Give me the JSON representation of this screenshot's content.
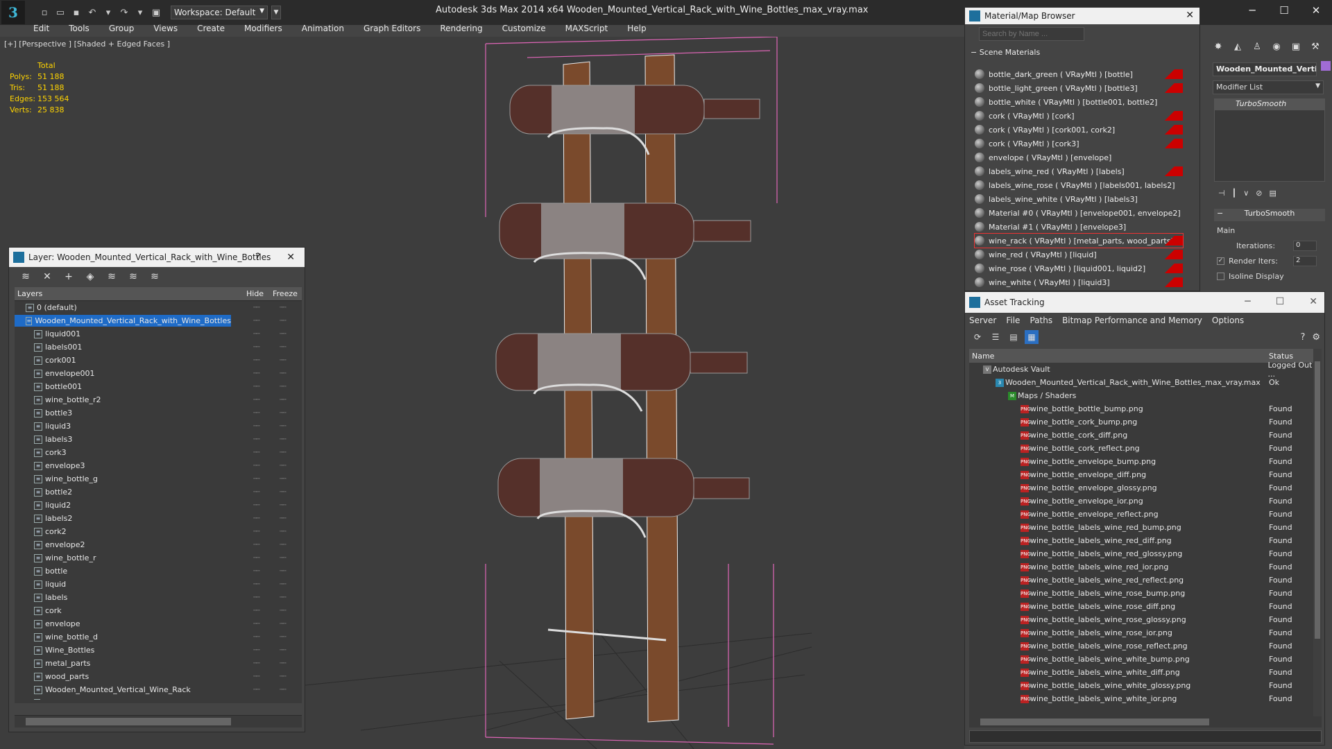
{
  "app": {
    "title": "Autodesk 3ds Max  2014 x64      Wooden_Mounted_Vertical_Rack_with_Wine_Bottles_max_vray.max",
    "workspace": "Workspace: Default",
    "logo": "3"
  },
  "menu": [
    "Edit",
    "Tools",
    "Group",
    "Views",
    "Create",
    "Modifiers",
    "Animation",
    "Graph Editors",
    "Rendering",
    "Customize",
    "MAXScript",
    "Help"
  ],
  "viewport": {
    "label": "[+] [Perspective ] [Shaded + Edged Faces ]",
    "stats": {
      "header": "Total",
      "polys_label": "Polys:",
      "polys": "51 188",
      "tris_label": "Tris:",
      "tris": "51 188",
      "edges_label": "Edges:",
      "edges": "153 564",
      "verts_label": "Verts:",
      "verts": "25 838"
    }
  },
  "layer_panel": {
    "title": "Layer: Wooden_Mounted_Vertical_Rack_with_Wine_Bottles",
    "help": "?",
    "close": "✕",
    "col_layers": "Layers",
    "col_hide": "Hide",
    "col_freeze": "Freeze",
    "rows": [
      {
        "name": "0 (default)",
        "indent": 1,
        "selected": false
      },
      {
        "name": "Wooden_Mounted_Vertical_Rack_with_Wine_Bottles",
        "indent": 1,
        "selected": true
      },
      {
        "name": "liquid001",
        "indent": 2
      },
      {
        "name": "labels001",
        "indent": 2
      },
      {
        "name": "cork001",
        "indent": 2
      },
      {
        "name": "envelope001",
        "indent": 2
      },
      {
        "name": "bottle001",
        "indent": 2
      },
      {
        "name": "wine_bottle_r2",
        "indent": 2
      },
      {
        "name": "bottle3",
        "indent": 2
      },
      {
        "name": "liquid3",
        "indent": 2
      },
      {
        "name": "labels3",
        "indent": 2
      },
      {
        "name": "cork3",
        "indent": 2
      },
      {
        "name": "envelope3",
        "indent": 2
      },
      {
        "name": "wine_bottle_g",
        "indent": 2
      },
      {
        "name": "bottle2",
        "indent": 2
      },
      {
        "name": "liquid2",
        "indent": 2
      },
      {
        "name": "labels2",
        "indent": 2
      },
      {
        "name": "cork2",
        "indent": 2
      },
      {
        "name": "envelope2",
        "indent": 2
      },
      {
        "name": "wine_bottle_r",
        "indent": 2
      },
      {
        "name": "bottle",
        "indent": 2
      },
      {
        "name": "liquid",
        "indent": 2
      },
      {
        "name": "labels",
        "indent": 2
      },
      {
        "name": "cork",
        "indent": 2
      },
      {
        "name": "envelope",
        "indent": 2
      },
      {
        "name": "wine_bottle_d",
        "indent": 2
      },
      {
        "name": "Wine_Bottles",
        "indent": 2
      },
      {
        "name": "metal_parts",
        "indent": 2
      },
      {
        "name": "wood_parts",
        "indent": 2
      },
      {
        "name": "Wooden_Mounted_Vertical_Wine_Rack",
        "indent": 2
      },
      {
        "name": "Wooden_Mounted_Vertical_Rack_with_Wine_Bottles",
        "indent": 2
      }
    ]
  },
  "material_browser": {
    "title": "Material/Map Browser",
    "search_placeholder": "Search by Name ...",
    "section": "Scene Materials",
    "items": [
      {
        "label": "bottle_dark_green  ( VRayMtl )  [bottle]",
        "badge": true
      },
      {
        "label": "bottle_light_green  ( VRayMtl )  [bottle3]",
        "badge": true
      },
      {
        "label": "bottle_white  ( VRayMtl )  [bottle001, bottle2]",
        "badge": false
      },
      {
        "label": "cork  ( VRayMtl )  [cork]",
        "badge": true
      },
      {
        "label": "cork  ( VRayMtl )  [cork001, cork2]",
        "badge": true
      },
      {
        "label": "cork  ( VRayMtl )  [cork3]",
        "badge": true
      },
      {
        "label": "envelope  ( VRayMtl )  [envelope]",
        "badge": false
      },
      {
        "label": "labels_wine_red  ( VRayMtl )  [labels]",
        "badge": true
      },
      {
        "label": "labels_wine_rose  ( VRayMtl )  [labels001, labels2]",
        "badge": false
      },
      {
        "label": "labels_wine_white  ( VRayMtl )  [labels3]",
        "badge": false
      },
      {
        "label": "Material #0  ( VRayMtl )  [envelope001, envelope2]",
        "badge": false
      },
      {
        "label": "Material #1  ( VRayMtl )  [envelope3]",
        "badge": false
      },
      {
        "label": "wine_rack  ( VRayMtl )  [metal_parts, wood_parts]",
        "badge": true,
        "selected": true
      },
      {
        "label": "wine_red  ( VRayMtl )  [liquid]",
        "badge": true
      },
      {
        "label": "wine_rose  ( VRayMtl )  [liquid001, liquid2]",
        "badge": true
      },
      {
        "label": "wine_white  ( VRayMtl )  [liquid3]",
        "badge": true
      }
    ]
  },
  "command_panel": {
    "object_name": "Wooden_Mounted_Vertic",
    "modifier_list": "Modifier List",
    "stack_item": "TurboSmooth",
    "rollout": "TurboSmooth",
    "group_main": "Main",
    "iterations_label": "Iterations:",
    "iterations": "0",
    "render_iters_label": "Render Iters:",
    "render_iters": "2",
    "isoline_label": "Isoline Display",
    "object_color": "#a06cd5"
  },
  "asset_tracking": {
    "title": "Asset Tracking",
    "menu": [
      "Server",
      "File",
      "Paths",
      "Bitmap Performance and Memory",
      "Options"
    ],
    "col_name": "Name",
    "col_status": "Status",
    "rows": [
      {
        "name": "Autodesk Vault",
        "status": "Logged Out ...",
        "type": "vault",
        "indent": 1
      },
      {
        "name": "Wooden_Mounted_Vertical_Rack_with_Wine_Bottles_max_vray.max",
        "status": "Ok",
        "type": "max",
        "indent": 2
      },
      {
        "name": "Maps / Shaders",
        "status": "",
        "type": "maps",
        "indent": 3
      },
      {
        "name": "wine_bottle_bottle_bump.png",
        "status": "Found",
        "type": "png",
        "indent": 4
      },
      {
        "name": "wine_bottle_cork_bump.png",
        "status": "Found",
        "type": "png",
        "indent": 4
      },
      {
        "name": "wine_bottle_cork_diff.png",
        "status": "Found",
        "type": "png",
        "indent": 4
      },
      {
        "name": "wine_bottle_cork_reflect.png",
        "status": "Found",
        "type": "png",
        "indent": 4
      },
      {
        "name": "wine_bottle_envelope_bump.png",
        "status": "Found",
        "type": "png",
        "indent": 4
      },
      {
        "name": "wine_bottle_envelope_diff.png",
        "status": "Found",
        "type": "png",
        "indent": 4
      },
      {
        "name": "wine_bottle_envelope_glossy.png",
        "status": "Found",
        "type": "png",
        "indent": 4
      },
      {
        "name": "wine_bottle_envelope_ior.png",
        "status": "Found",
        "type": "png",
        "indent": 4
      },
      {
        "name": "wine_bottle_envelope_reflect.png",
        "status": "Found",
        "type": "png",
        "indent": 4
      },
      {
        "name": "wine_bottle_labels_wine_red_bump.png",
        "status": "Found",
        "type": "png",
        "indent": 4
      },
      {
        "name": "wine_bottle_labels_wine_red_diff.png",
        "status": "Found",
        "type": "png",
        "indent": 4
      },
      {
        "name": "wine_bottle_labels_wine_red_glossy.png",
        "status": "Found",
        "type": "png",
        "indent": 4
      },
      {
        "name": "wine_bottle_labels_wine_red_ior.png",
        "status": "Found",
        "type": "png",
        "indent": 4
      },
      {
        "name": "wine_bottle_labels_wine_red_reflect.png",
        "status": "Found",
        "type": "png",
        "indent": 4
      },
      {
        "name": "wine_bottle_labels_wine_rose_bump.png",
        "status": "Found",
        "type": "png",
        "indent": 4
      },
      {
        "name": "wine_bottle_labels_wine_rose_diff.png",
        "status": "Found",
        "type": "png",
        "indent": 4
      },
      {
        "name": "wine_bottle_labels_wine_rose_glossy.png",
        "status": "Found",
        "type": "png",
        "indent": 4
      },
      {
        "name": "wine_bottle_labels_wine_rose_ior.png",
        "status": "Found",
        "type": "png",
        "indent": 4
      },
      {
        "name": "wine_bottle_labels_wine_rose_reflect.png",
        "status": "Found",
        "type": "png",
        "indent": 4
      },
      {
        "name": "wine_bottle_labels_wine_white_bump.png",
        "status": "Found",
        "type": "png",
        "indent": 4
      },
      {
        "name": "wine_bottle_labels_wine_white_diff.png",
        "status": "Found",
        "type": "png",
        "indent": 4
      },
      {
        "name": "wine_bottle_labels_wine_white_glossy.png",
        "status": "Found",
        "type": "png",
        "indent": 4
      },
      {
        "name": "wine_bottle_labels_wine_white_ior.png",
        "status": "Found",
        "type": "png",
        "indent": 4
      }
    ]
  }
}
